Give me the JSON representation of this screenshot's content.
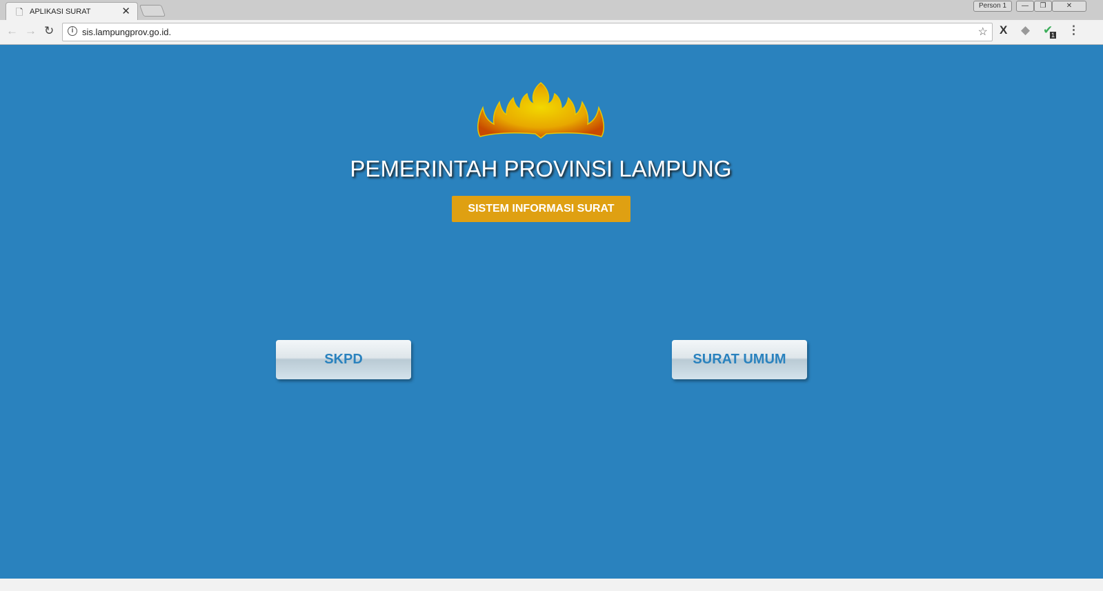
{
  "browser": {
    "tab_title": "APLIKASI SURAT",
    "profile": "Person 1",
    "url": "sis.lampungprov.go.id.",
    "extension_badge": "1"
  },
  "page": {
    "title": "PEMERINTAH PROVINSI LAMPUNG",
    "subtitle": "SISTEM INFORMASI SURAT",
    "buttons": [
      {
        "label": "SKPD"
      },
      {
        "label": "SURAT UMUM"
      }
    ],
    "colors": {
      "background": "#2a82be",
      "badge": "#dfa012",
      "button_text": "#2a82be"
    }
  }
}
